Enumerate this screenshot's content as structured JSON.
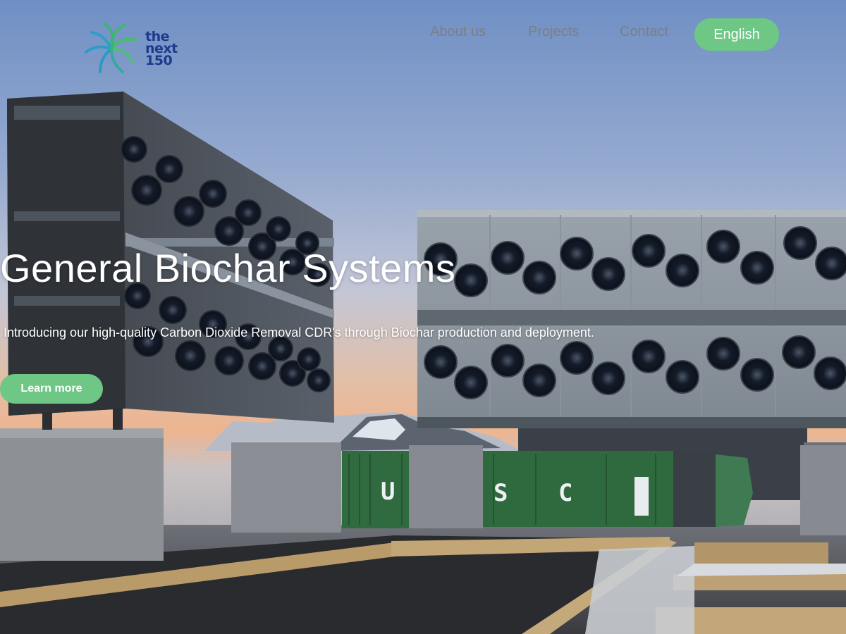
{
  "brand": {
    "logo_lines": [
      "the",
      "next",
      "150"
    ],
    "colors": {
      "logo_green": "#3fb96c",
      "logo_teal": "#2b9ec7",
      "logo_navy": "#1e3a8a"
    }
  },
  "nav": {
    "links": [
      {
        "label": "About us"
      },
      {
        "label": "Projects"
      },
      {
        "label": "Contact"
      }
    ],
    "language_button": "English"
  },
  "hero": {
    "title": "General Biochar Systems",
    "subtitle": "Introducing our high-quality Carbon Dioxide Removal CDR's through Biochar production and deployment.",
    "cta_label": "Learn more",
    "container_letters": [
      "U",
      "S",
      "C"
    ]
  },
  "theme": {
    "accent": "#6ec784",
    "nav_text": "#7b7f86",
    "hero_text": "#ffffff"
  },
  "icons": [
    "logo-swirl-icon"
  ]
}
